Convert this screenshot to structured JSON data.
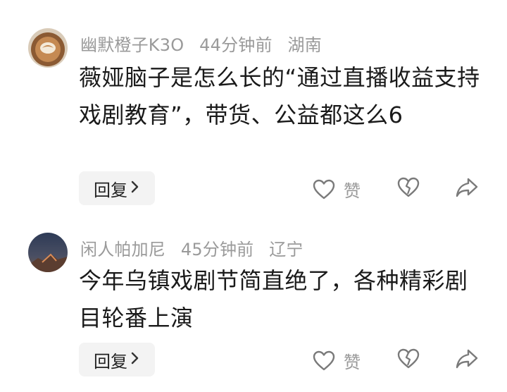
{
  "top_partial_text": "…",
  "comments": [
    {
      "username": "幽默橙子K3O",
      "time": "44分钟前",
      "location": "湖南",
      "text": "薇娅脑子是怎么长的“通过直播收益支持戏剧教育”，带货、公益都这么6",
      "reply_label": "回复",
      "like_label": "赞"
    },
    {
      "username": "闲人帕加尼",
      "time": "45分钟前",
      "location": "辽宁",
      "text": "今年乌镇戏剧节简直绝了，各种精彩剧目轮番上演",
      "reply_label": "回复",
      "like_label": "赞"
    }
  ],
  "icons": {
    "like": "heart-icon",
    "dislike": "broken-heart-icon",
    "share": "share-arrow-icon",
    "reply_chevron": "chevron-right-icon"
  },
  "colors": {
    "meta_text": "#9a9a9a",
    "body_text": "#1a1a1a",
    "reply_bg": "#f3f3f3",
    "icon": "#888888"
  }
}
